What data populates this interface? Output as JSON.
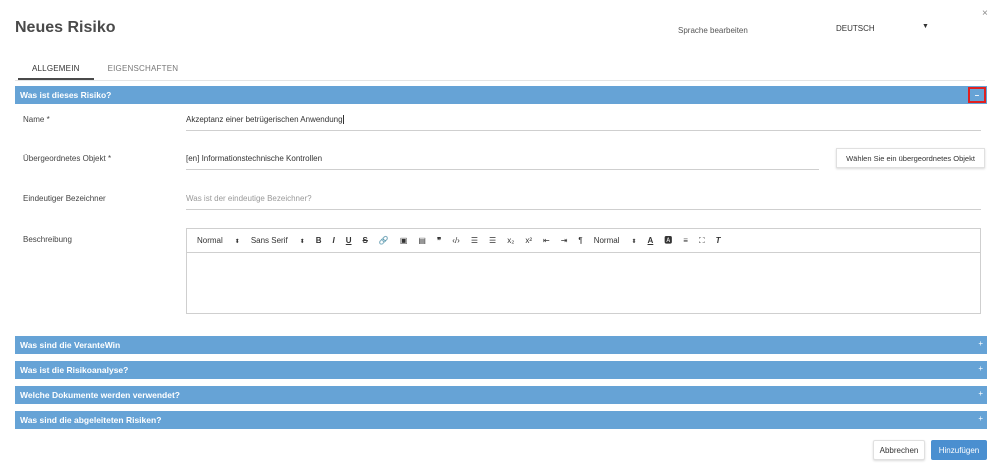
{
  "dialog": {
    "title": "Neues Risiko",
    "language_label": "Sprache bearbeiten",
    "language_value": "DEUTSCH",
    "close_glyph": "×"
  },
  "tabs": [
    {
      "label": "ALLGEMEIN",
      "active": true
    },
    {
      "label": "EIGENSCHAFTEN",
      "active": false
    }
  ],
  "sections": {
    "what_is": {
      "label": "Was ist dieses Risiko?",
      "toggle": "–"
    },
    "responsible": {
      "label": "Was sind die VeranteWin",
      "toggle": "+"
    },
    "analysis": {
      "label": "Was ist die Risikoanalyse?",
      "toggle": "+"
    },
    "documents": {
      "label": "Welche Dokumente werden verwendet?",
      "toggle": "+"
    },
    "derived": {
      "label": "Was sind die abgeleiteten Risiken?",
      "toggle": "+"
    }
  },
  "form": {
    "name_label": "Name *",
    "name_value": "Akzeptanz einer betrügerischen Anwendung",
    "parent_label": "Übergeordnetes Objekt *",
    "parent_value": "[en] Informationstechnische Kontrollen",
    "parent_button": "Wählen Sie ein übergeordnetes Objekt",
    "identifier_label": "Eindeutiger Bezeichner",
    "identifier_placeholder": "Was ist der eindeutige Bezeichner?",
    "description_label": "Beschreibung"
  },
  "editor_toolbar": {
    "heading": "Normal",
    "font": "Sans Serif",
    "bold": "B",
    "italic": "I",
    "underline": "U",
    "strike": "S",
    "dropdown_caret": "⬍",
    "size": "Normal"
  },
  "icons": [
    "bold-icon",
    "italic-icon",
    "underline-icon",
    "strike-icon",
    "link-icon",
    "image-icon",
    "video-icon",
    "quote-icon",
    "code-icon",
    "ordered-list-icon",
    "bullet-list-icon",
    "subscript-icon",
    "superscript-icon",
    "outdent-icon",
    "indent-icon",
    "rtl-icon",
    "text-color-icon",
    "background-color-icon",
    "align-icon",
    "fullscreen-icon",
    "clear-format-icon"
  ],
  "buttons": {
    "cancel": "Abbrechen",
    "add": "Hinzufügen"
  },
  "colors": {
    "section_bar": "#66a3d6",
    "primary_button": "#4a8fd0",
    "highlight_border": "#e02020"
  }
}
